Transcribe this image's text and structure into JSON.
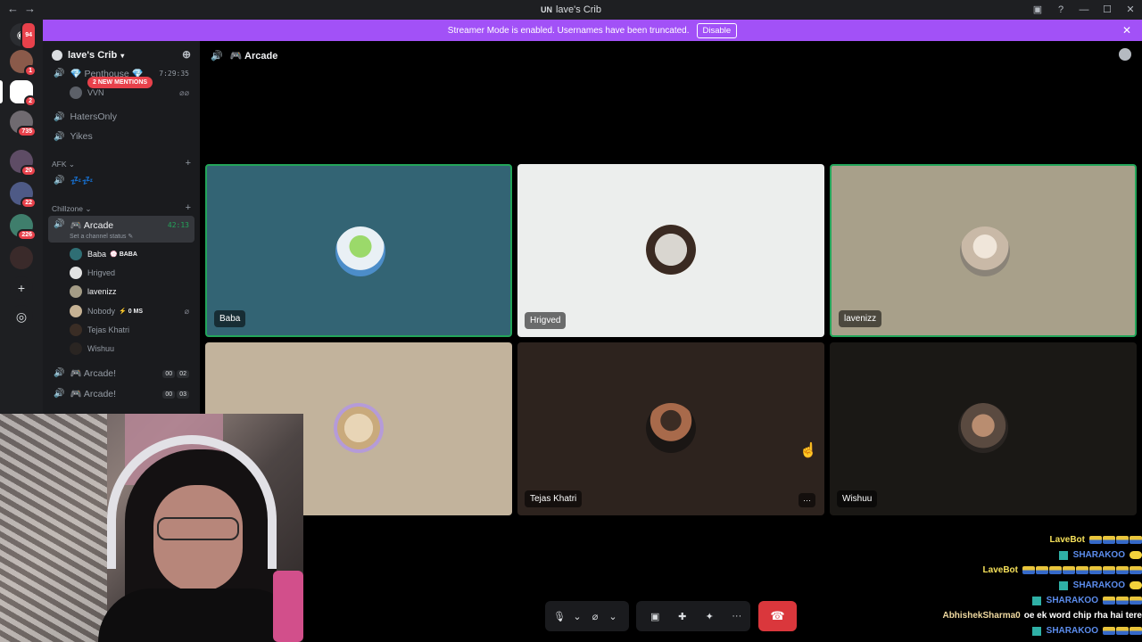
{
  "window": {
    "title": "lave's Crib",
    "logo": "UN"
  },
  "banner": {
    "text": "Streamer Mode is enabled. Usernames have been truncated.",
    "disable_label": "Disable",
    "color": "#a251f7"
  },
  "rail": {
    "badges": [
      "94",
      "1",
      "2",
      "735",
      "20",
      "22",
      "226"
    ]
  },
  "guild": {
    "name": "lave's Crib"
  },
  "channels": {
    "penthouse": {
      "name": "💎 Penthouse 💎",
      "time": "7:29:35",
      "member": "VVN"
    },
    "mentions": "2 NEW MENTIONS",
    "hatersonly": "HatersOnly",
    "yikes": "Yikes",
    "afk_category": "AFK",
    "afk_channel": "💤💤",
    "chillzone_category": "Chillzone",
    "arcade": {
      "name": "🎮 Arcade",
      "time": "42:13",
      "status": "Set a channel status ✎"
    },
    "members": [
      {
        "name": "Baba",
        "tag": "💮 BABA"
      },
      {
        "name": "Hrigved",
        "tag": ""
      },
      {
        "name": "lavenizz",
        "tag": ""
      },
      {
        "name": "Nobody",
        "tag": "⚡ 0 MS"
      },
      {
        "name": "Tejas Khatri",
        "tag": ""
      },
      {
        "name": "Wishuu",
        "tag": ""
      }
    ],
    "arcade2": {
      "name": "🎮 Arcade!",
      "c1": "00",
      "c2": "02"
    },
    "arcade3": {
      "name": "🎮 Arcade!",
      "c1": "00",
      "c2": "03"
    }
  },
  "topbar": {
    "channel": "🎮 Arcade"
  },
  "tiles": [
    {
      "name": "Baba",
      "bg": "#336474",
      "speaking": true
    },
    {
      "name": "Hrigved",
      "bg": "#eceeed",
      "speaking": false
    },
    {
      "name": "lavenizz",
      "bg": "#a8a08a",
      "speaking": true
    },
    {
      "name": "",
      "bg": "#c2b39c",
      "speaking": false
    },
    {
      "name": "Tejas Khatri",
      "bg": "#2d231e",
      "speaking": false
    },
    {
      "name": "Wishuu",
      "bg": "#1a1815",
      "speaking": false
    }
  ],
  "tile_menu": "···",
  "chat_overlay": [
    {
      "user": "LaveBot",
      "color": "#f5e05a",
      "badge": false,
      "text": "",
      "emotes": 4,
      "emote_style": "flag"
    },
    {
      "user": "SHARAKOO",
      "color": "#5c8ded",
      "badge": true,
      "text": "",
      "emotes": 1,
      "emote_style": "yellow"
    },
    {
      "user": "LaveBot",
      "color": "#f5e05a",
      "badge": false,
      "text": "",
      "emotes": 9,
      "emote_style": "flag"
    },
    {
      "user": "SHARAKOO",
      "color": "#5c8ded",
      "badge": true,
      "text": "",
      "emotes": 1,
      "emote_style": "yellow"
    },
    {
      "user": "SHARAKOO",
      "color": "#5c8ded",
      "badge": true,
      "text": "",
      "emotes": 3,
      "emote_style": "flag"
    },
    {
      "user": "AbhishekSharma0",
      "color": "#efd9a0",
      "badge": false,
      "text": "oe ek word chip rha hai tere",
      "emotes": 0,
      "emote_style": ""
    },
    {
      "user": "SHARAKOO",
      "color": "#5c8ded",
      "badge": true,
      "text": "",
      "emotes": 3,
      "emote_style": "flag"
    }
  ]
}
